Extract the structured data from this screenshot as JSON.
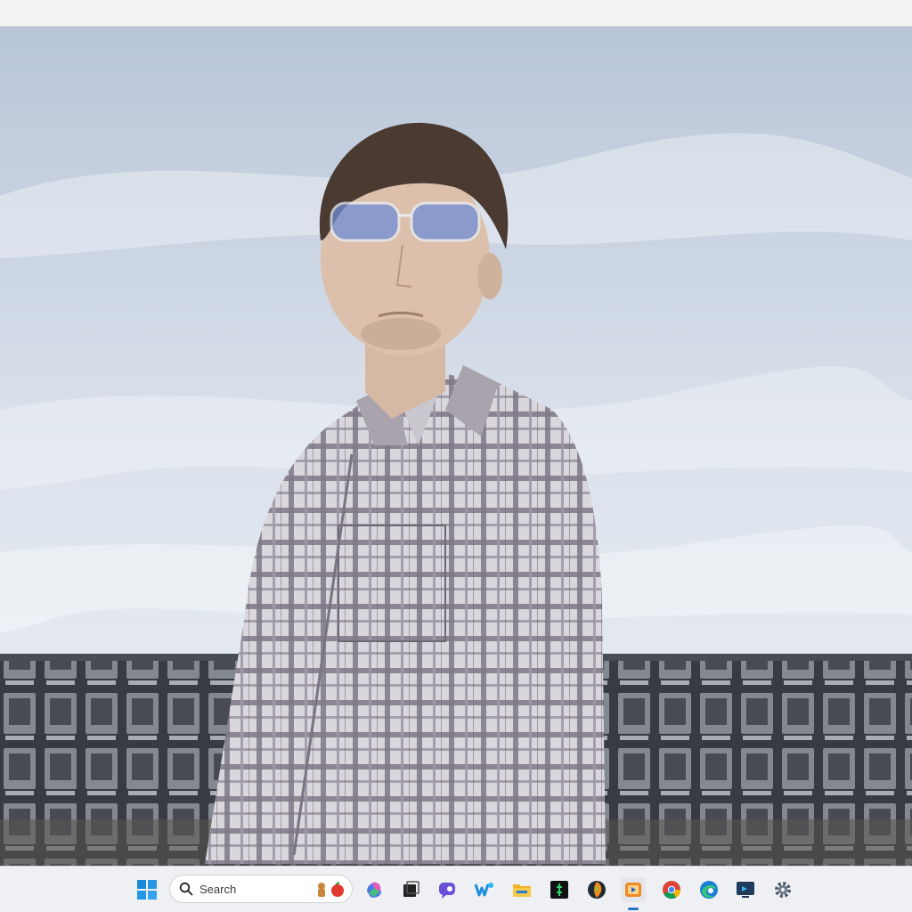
{
  "photo": {
    "subject": "person-photo"
  },
  "taskbar": {
    "search": {
      "label": "Search"
    },
    "apps": [
      {
        "name": "start"
      },
      {
        "name": "copilot"
      },
      {
        "name": "task-view"
      },
      {
        "name": "chat"
      },
      {
        "name": "word"
      },
      {
        "name": "file-explorer"
      },
      {
        "name": "terminal"
      },
      {
        "name": "fl-studio"
      },
      {
        "name": "media-player"
      },
      {
        "name": "chrome"
      },
      {
        "name": "edge"
      },
      {
        "name": "remote-desktop"
      },
      {
        "name": "settings"
      }
    ]
  }
}
